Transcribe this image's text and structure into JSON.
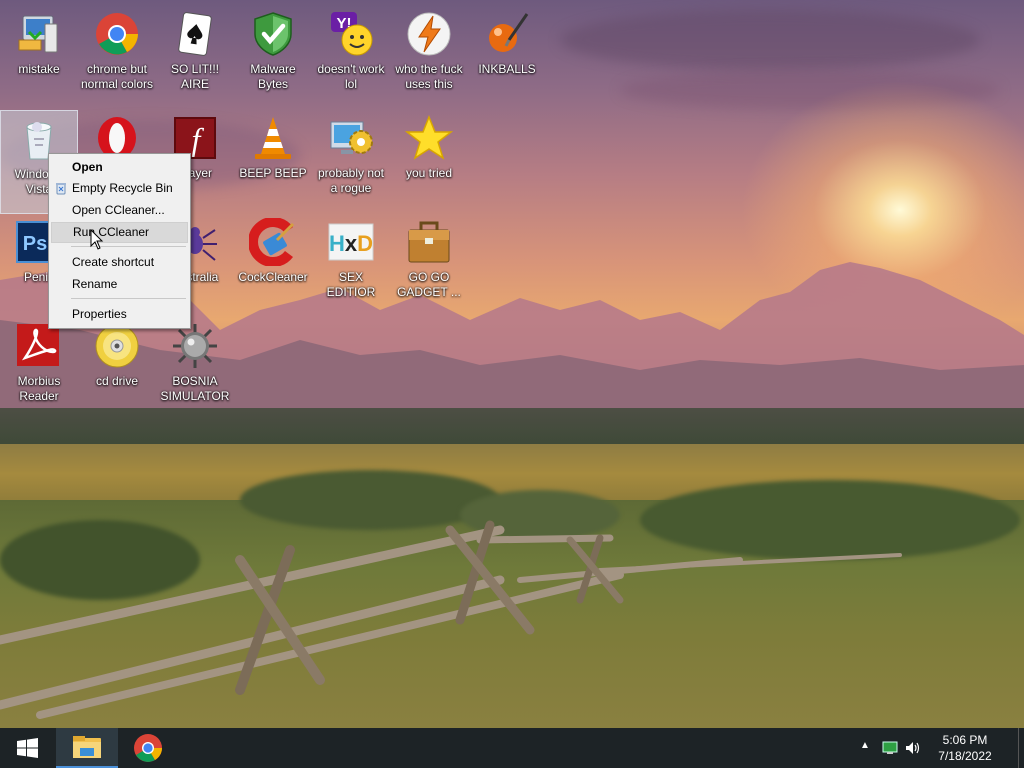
{
  "desktop_icons": [
    {
      "label": "mistake",
      "icon": "pc-setup-icon"
    },
    {
      "label": "chrome but normal colors",
      "icon": "chrome-icon"
    },
    {
      "label": "SO LIT!!! AIRE",
      "icon": "solitaire-icon"
    },
    {
      "label": "Malware Bytes",
      "icon": "shield-check-icon"
    },
    {
      "label": "doesn't work lol",
      "icon": "yahoo-messenger-icon"
    },
    {
      "label": "who the fuck uses this",
      "icon": "winamp-bolt-icon"
    },
    {
      "label": "INKBALLS",
      "icon": "inkball-icon"
    },
    {
      "label": "Windows Vista",
      "icon": "recycle-bin-icon"
    },
    {
      "label": "",
      "icon": "opera-icon"
    },
    {
      "label": "Player",
      "icon": "flash-player-icon"
    },
    {
      "label": "BEEP BEEP",
      "icon": "vlc-cone-icon"
    },
    {
      "label": "probably not a rogue",
      "icon": "gear-monitor-icon"
    },
    {
      "label": "you tried",
      "icon": "star-icon"
    },
    {
      "label": "Penis",
      "icon": "photoshop-icon"
    },
    {
      "label": "Australia",
      "icon": "spider-icon"
    },
    {
      "label": "CockCleaner",
      "icon": "ccleaner-icon"
    },
    {
      "label": "SEX EDITIOR",
      "icon": "hxd-icon"
    },
    {
      "label": "GO GO GADGET ...",
      "icon": "briefcase-icon"
    },
    {
      "label": "Morbius Reader",
      "icon": "acrobat-icon"
    },
    {
      "label": "cd drive",
      "icon": "cd-icon"
    },
    {
      "label": "BOSNIA SIMULATOR",
      "icon": "mine-icon"
    }
  ],
  "context_menu": {
    "items": [
      {
        "label": "Open"
      },
      {
        "label": "Empty Recycle Bin"
      },
      {
        "label": "Open CCleaner..."
      },
      {
        "label": "Run CCleaner"
      },
      {
        "label": "Create shortcut"
      },
      {
        "label": "Rename"
      },
      {
        "label": "Properties"
      }
    ]
  },
  "taskbar": {
    "start": "windows-logo-icon",
    "pinned": [
      "file-explorer-icon",
      "chrome-icon"
    ],
    "tray": {
      "time": "5:06 PM",
      "date": "7/18/2022"
    }
  },
  "colors": {
    "taskbar": "#1d2326",
    "menu_bg": "#f0f0f0",
    "menu_hover": "#d9d9d9",
    "selection": "#c8cdd7"
  }
}
